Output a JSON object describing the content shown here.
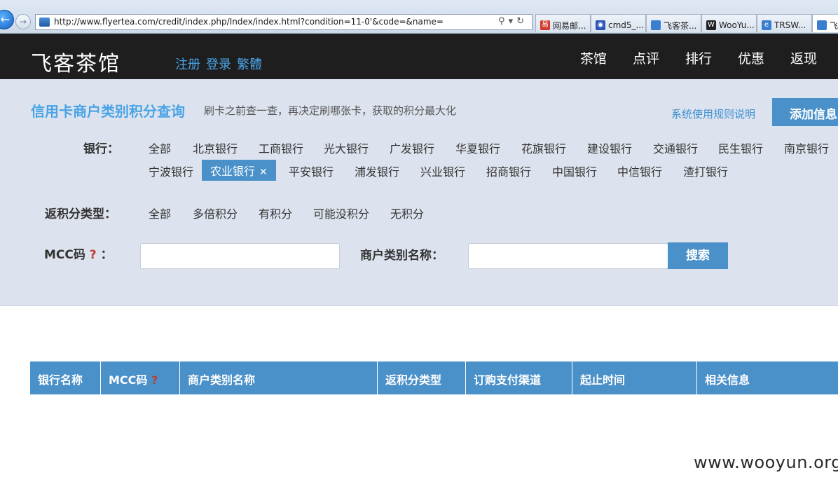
{
  "browser": {
    "url": "http://www.flyertea.com/credit/index.php/Index/index.html?condition=11-0'&code=&name=",
    "tabs": [
      {
        "label": "网易邮...",
        "icon_color": "#d23a2b"
      },
      {
        "label": "cmd5_...",
        "icon_color": "#2a54b8"
      },
      {
        "label": "飞客茶...",
        "icon_color": "#3a7fcf"
      },
      {
        "label": "WooYu...",
        "icon_color": "#222222"
      },
      {
        "label": "TRSW...",
        "icon_color": "#3a7fcf"
      },
      {
        "label": "飞",
        "icon_color": "#3a7fcf"
      }
    ]
  },
  "header": {
    "logo": "飞客茶馆",
    "auth": [
      "注册",
      "登录",
      "繁體"
    ],
    "nav": [
      "茶馆",
      "点评",
      "排行",
      "优惠",
      "返现"
    ]
  },
  "panel": {
    "title": "信用卡商户类别积分查询",
    "subtitle": "刷卡之前查一查，再决定刷哪张卡，获取的积分最大化",
    "rules_link": "系统使用规则说明",
    "add_button": "添加信息",
    "bank_label": "银行：",
    "banks_row1": [
      "全部",
      "北京银行",
      "工商银行",
      "光大银行",
      "广发银行",
      "华夏银行",
      "花旗银行",
      "建设银行",
      "交通银行",
      "民生银行",
      "南京银行"
    ],
    "banks_row2": [
      "宁波银行",
      "农业银行",
      "平安银行",
      "浦发银行",
      "兴业银行",
      "招商银行",
      "中国银行",
      "中信银行",
      "渣打银行"
    ],
    "selected_bank": "农业银行",
    "type_label": "返积分类型：",
    "types": [
      "全部",
      "多倍积分",
      "有积分",
      "可能没积分",
      "无积分"
    ],
    "mcc_label": "MCC码",
    "mcc_help": "?",
    "colon": "：",
    "merchant_label": "商户类别名称：",
    "mcc_value": "",
    "merchant_value": "",
    "search_button": "搜索"
  },
  "table": {
    "columns": [
      "银行名称",
      "MCC码",
      "商户类别名称",
      "返积分类型",
      "订购支付渠道",
      "起止时间",
      "相关信息"
    ],
    "mcc_help": "?"
  },
  "watermark": "www.wooyun.org"
}
